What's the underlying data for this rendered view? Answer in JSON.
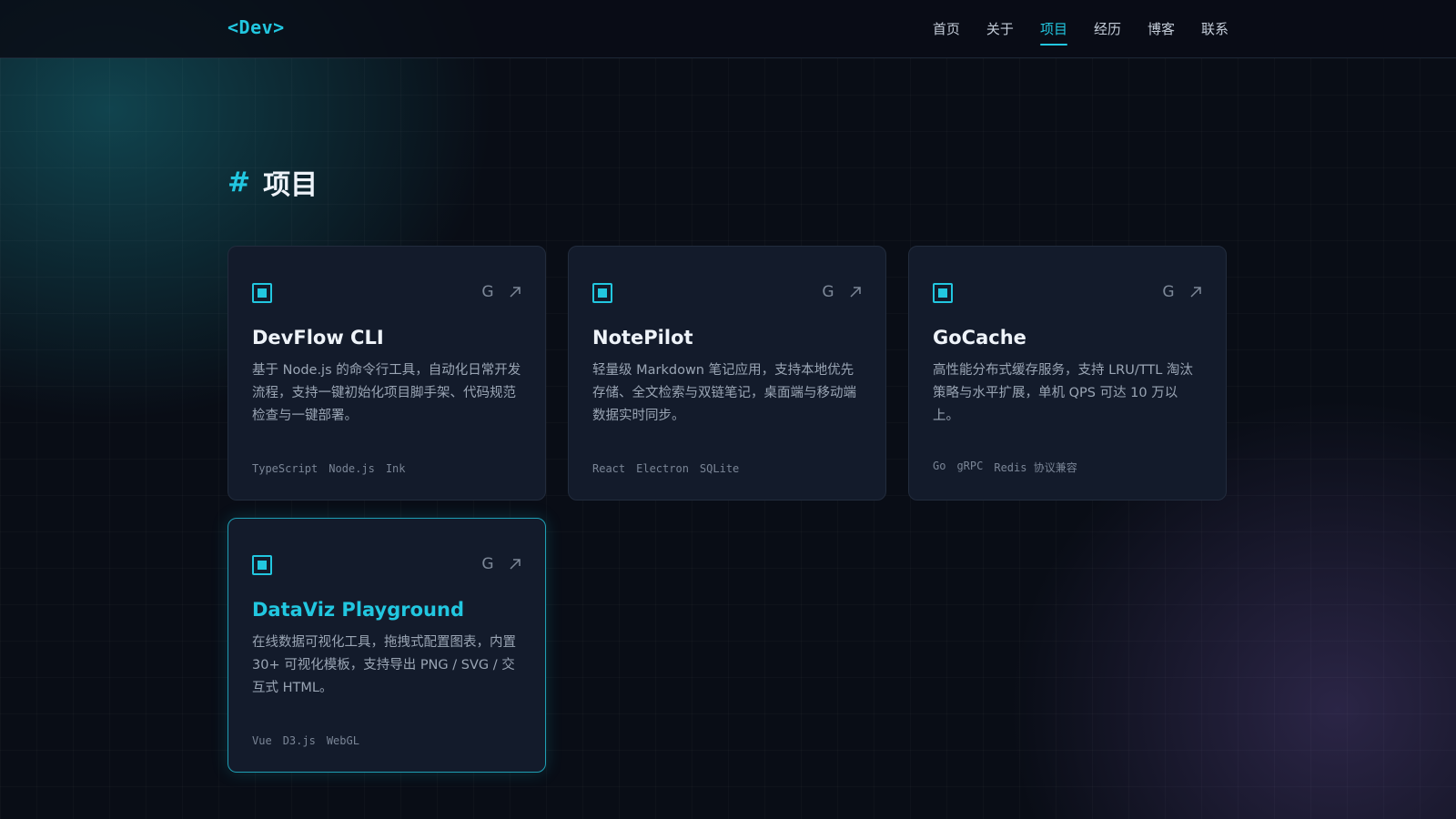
{
  "nav": {
    "logo": "<Dev>",
    "links": [
      {
        "label": "首页"
      },
      {
        "label": "关于"
      },
      {
        "label": "项目"
      },
      {
        "label": "经历"
      },
      {
        "label": "博客"
      },
      {
        "label": "联系"
      }
    ],
    "active_index": 2
  },
  "section": {
    "hash": "#",
    "title": "项目"
  },
  "card_action_github": "G",
  "projects": [
    {
      "title": "DevFlow CLI",
      "description": "基于 Node.js 的命令行工具，自动化日常开发流程，支持一键初始化项目脚手架、代码规范检查与一键部署。",
      "tags": [
        "TypeScript",
        "Node.js",
        "Ink"
      ]
    },
    {
      "title": "NotePilot",
      "description": "轻量级 Markdown 笔记应用，支持本地优先存储、全文检索与双链笔记，桌面端与移动端数据实时同步。",
      "tags": [
        "React",
        "Electron",
        "SQLite"
      ]
    },
    {
      "title": "GoCache",
      "description": "高性能分布式缓存服务，支持 LRU/TTL 淘汰策略与水平扩展，单机 QPS 可达 10 万以上。",
      "tags": [
        "Go",
        "gRPC",
        "Redis 协议兼容"
      ]
    },
    {
      "title": "DataViz Playground",
      "description": "在线数据可视化工具，拖拽式配置图表，内置 30+ 可视化模板，支持导出 PNG / SVG / 交互式 HTML。",
      "tags": [
        "Vue",
        "D3.js",
        "WebGL"
      ]
    }
  ],
  "colors": {
    "accent": "#22c7e0",
    "background": "#090d16",
    "card": "#131b2b"
  },
  "icons": {
    "project": "chip-square-icon",
    "github": "github-icon",
    "external": "external-link-icon"
  }
}
